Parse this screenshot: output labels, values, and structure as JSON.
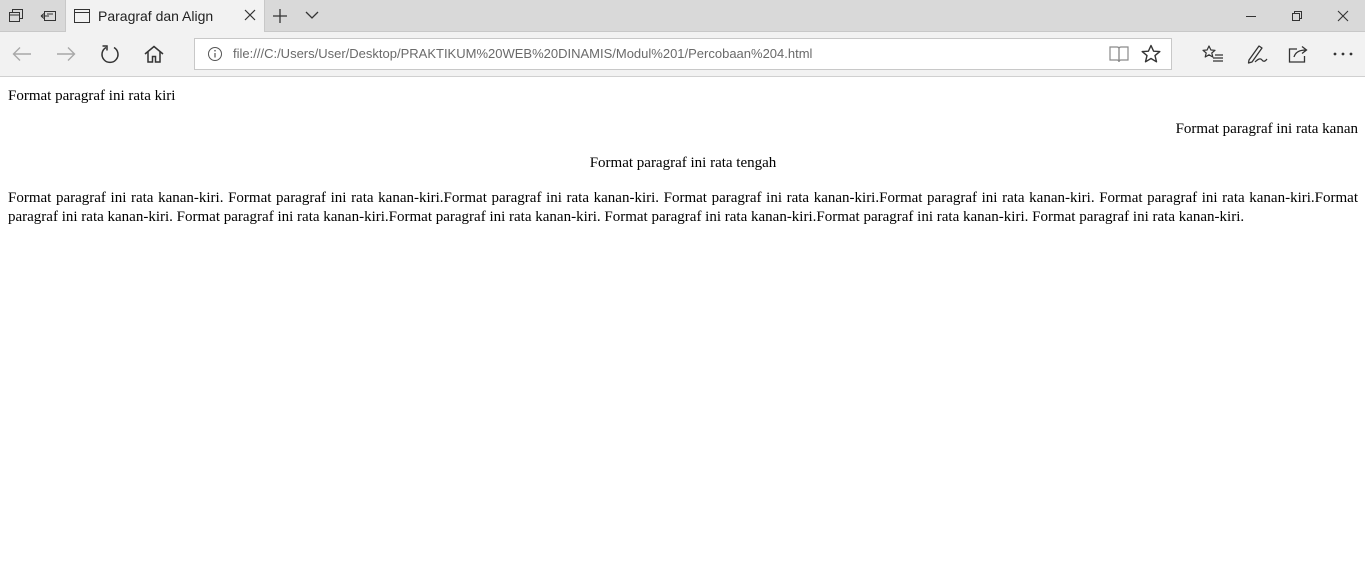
{
  "browser": {
    "tab": {
      "title": "Paragraf dan Align"
    },
    "address_bar": {
      "url": "file:///C:/Users/User/Desktop/PRAKTIKUM%20WEB%20DINAMIS/Modul%201/Percobaan%204.html"
    },
    "icons": {
      "tab_strip": [
        "tabs-overview-icon",
        "set-aside-tabs-icon",
        "page-icon",
        "close-tab-icon",
        "new-tab-icon",
        "tab-list-icon"
      ],
      "window_controls": [
        "minimize-icon",
        "restore-icon",
        "close-window-icon"
      ],
      "toolbar": [
        "back-icon",
        "forward-icon",
        "refresh-icon",
        "home-icon",
        "info-icon",
        "reading-view-icon",
        "favorite-star-icon",
        "favorites-hub-icon",
        "pen-icon",
        "share-icon",
        "more-icon"
      ]
    }
  },
  "page": {
    "para_left": "Format paragraf ini rata kiri",
    "para_right": "Format paragraf ini rata kanan",
    "para_center": "Format paragraf ini rata tengah",
    "para_justify": "Format paragraf ini rata kanan-kiri. Format paragraf ini rata kanan-kiri.Format paragraf ini rata kanan-kiri. Format paragraf ini rata kanan-kiri.Format paragraf ini rata kanan-kiri. Format paragraf ini rata kanan-kiri.Format paragraf ini rata kanan-kiri. Format paragraf ini rata kanan-kiri.Format paragraf ini rata kanan-kiri. Format paragraf ini rata kanan-kiri.Format paragraf ini rata kanan-kiri. Format paragraf ini rata kanan-kiri."
  }
}
